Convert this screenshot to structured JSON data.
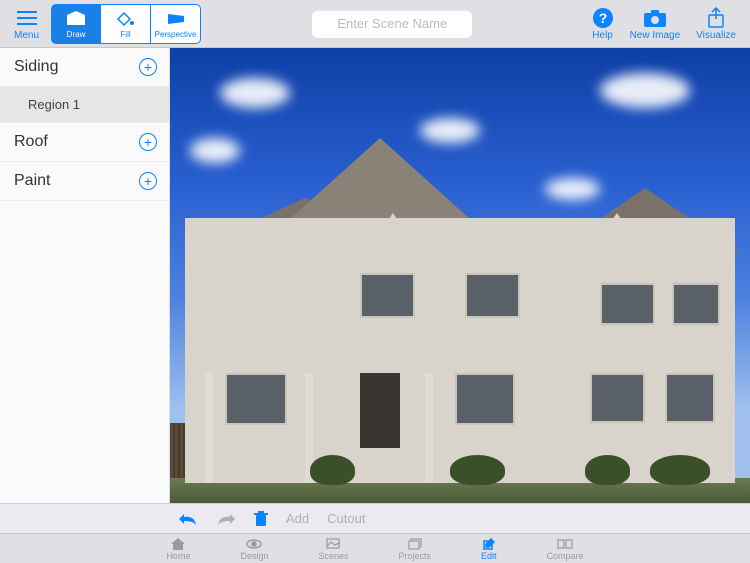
{
  "toolbar": {
    "menu_label": "Menu",
    "draw_label": "Draw",
    "fill_label": "Fill",
    "perspective_label": "Perspective",
    "scene_placeholder": "Enter Scene Name",
    "help_label": "Help",
    "new_image_label": "New Image",
    "visualize_label": "Visualize"
  },
  "sidebar": {
    "categories": [
      {
        "label": "Siding",
        "regions": [
          {
            "label": "Region 1"
          }
        ]
      },
      {
        "label": "Roof",
        "regions": []
      },
      {
        "label": "Paint",
        "regions": []
      }
    ]
  },
  "edit_bar": {
    "undo_label": "Undo",
    "redo_label": "Redo",
    "delete_label": "Delete",
    "add_label": "Add",
    "cutout_label": "Cutout"
  },
  "bottom_tabs": {
    "home": "Home",
    "design": "Design",
    "scenes": "Scenes",
    "projects": "Projects",
    "edit": "Edit",
    "compare": "Compare"
  }
}
